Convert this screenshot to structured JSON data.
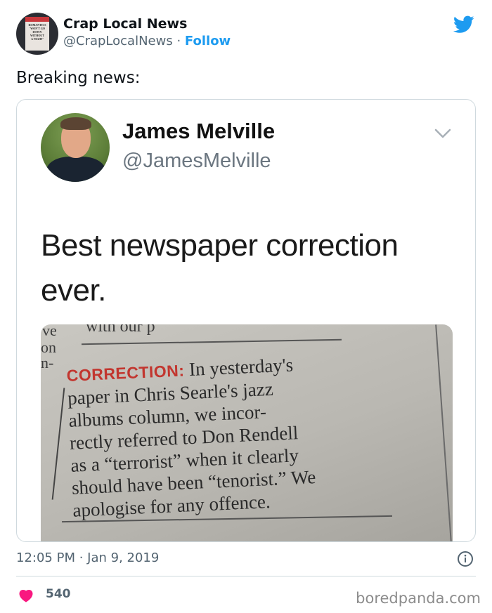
{
  "author": {
    "display_name": "Crap Local News",
    "handle": "@CrapLocalNews",
    "separator": "·",
    "follow_label": "Follow",
    "avatar_lines": [
      "Southport Express",
      "ROMANTICS",
      "'WON'T GO",
      "DOWN",
      "WITHOUT",
      "A FIGHT'",
      "Express"
    ]
  },
  "tweet": {
    "text": "Breaking news:",
    "timestamp": "12:05 PM · Jan 9, 2019",
    "likes": "540"
  },
  "quoted": {
    "display_name": "James Melville",
    "handle": "@JamesMelville",
    "text": "Best newspaper correction ever.",
    "clipping": {
      "label": "CORRECTION:",
      "lines": [
        " In yesterday's",
        "paper in Chris Searle's jazz",
        "albums column, we incor-",
        "rectly referred to Don Rendell",
        "as a “terrorist” when it clearly",
        "should have been “tenorist.” We",
        "apologise for any offence."
      ],
      "left_margin": [
        "ve",
        "on",
        "n-"
      ],
      "top_text": "with our p"
    }
  },
  "watermark": "boredpanda.com",
  "colors": {
    "accent": "#1d9bf0",
    "heart": "#f91880",
    "correction_red": "#c2362f",
    "muted": "#536471"
  },
  "icons": [
    "twitter-bird-icon",
    "chevron-down-icon",
    "info-icon",
    "heart-icon"
  ]
}
